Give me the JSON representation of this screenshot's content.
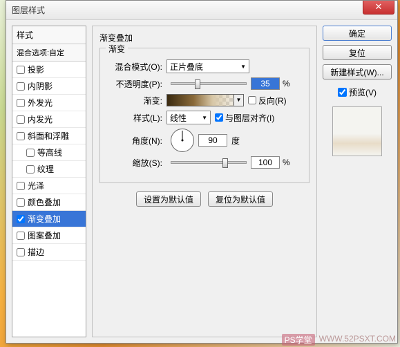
{
  "title": "图层样式",
  "close": "✕",
  "left": {
    "header": "样式",
    "sub": "混合选项:自定",
    "items": [
      {
        "label": "投影",
        "checked": false,
        "indent": false
      },
      {
        "label": "内阴影",
        "checked": false,
        "indent": false
      },
      {
        "label": "外发光",
        "checked": false,
        "indent": false
      },
      {
        "label": "内发光",
        "checked": false,
        "indent": false
      },
      {
        "label": "斜面和浮雕",
        "checked": false,
        "indent": false
      },
      {
        "label": "等高线",
        "checked": false,
        "indent": true
      },
      {
        "label": "纹理",
        "checked": false,
        "indent": true
      },
      {
        "label": "光泽",
        "checked": false,
        "indent": false
      },
      {
        "label": "颜色叠加",
        "checked": false,
        "indent": false
      },
      {
        "label": "渐变叠加",
        "checked": true,
        "indent": false,
        "selected": true
      },
      {
        "label": "图案叠加",
        "checked": false,
        "indent": false
      },
      {
        "label": "描边",
        "checked": false,
        "indent": false
      }
    ]
  },
  "mid": {
    "title": "渐变叠加",
    "legend": "渐变",
    "blend_label": "混合模式(O):",
    "blend_value": "正片叠底",
    "opacity_label": "不透明度(P):",
    "opacity_value": "35",
    "opacity_pct": "%",
    "grad_label": "渐变:",
    "reverse_label": "反向(R)",
    "style_label": "样式(L):",
    "style_value": "线性",
    "align_label": "与图层对齐(I)",
    "angle_label": "角度(N):",
    "angle_value": "90",
    "angle_unit": "度",
    "scale_label": "缩放(S):",
    "scale_value": "100",
    "scale_pct": "%",
    "btn_default": "设置为默认值",
    "btn_reset": "复位为默认值"
  },
  "right": {
    "ok": "确定",
    "cancel": "复位",
    "newstyle": "新建样式(W)...",
    "preview": "预览(V)"
  },
  "watermark": {
    "tag": "PS学堂",
    "url": "WWW.52PSXT.COM"
  }
}
